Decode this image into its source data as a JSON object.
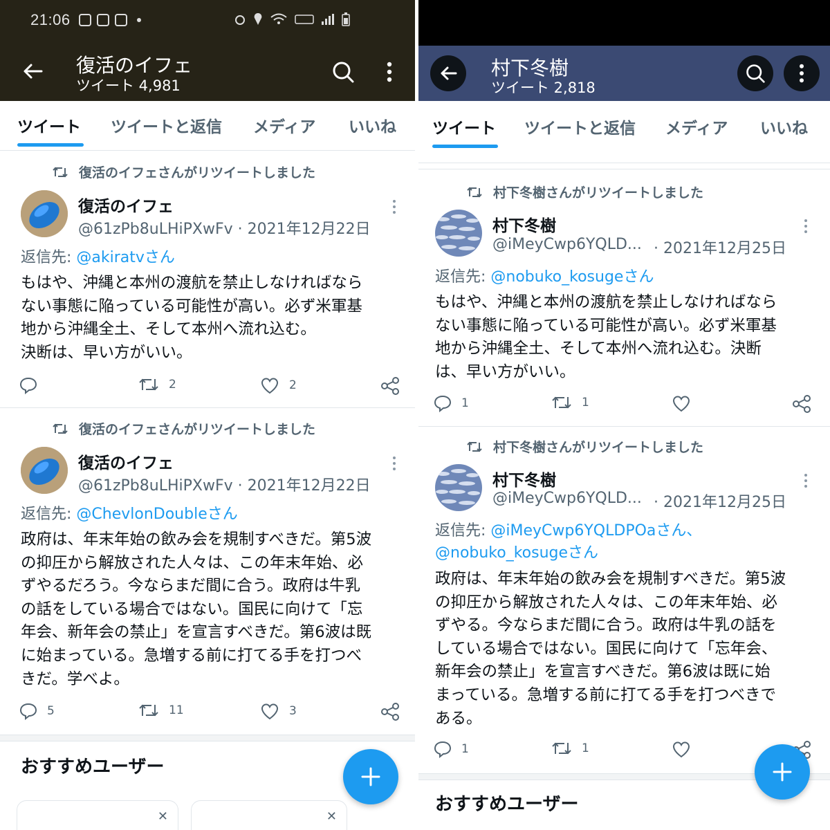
{
  "left": {
    "status_bar": {
      "time": "21:06"
    },
    "header": {
      "title": "復活のイフェ",
      "subtitle": "ツイート 4,981",
      "bg_color": "#262317"
    },
    "tabs": [
      {
        "label": "ツイート"
      },
      {
        "label": "ツイートと返信"
      },
      {
        "label": "メディア"
      },
      {
        "label": "いいね"
      }
    ],
    "tweets": [
      {
        "retweet_label": "復活のイフェさんがリツイートしました",
        "name": "復活のイフェ",
        "handle": "@61zPb8uLHiPXwFv · 2021年12月22日",
        "reply_prefix": "返信先: ",
        "reply_to": "@akiratvさん",
        "body": [
          "もはや、沖縄と本州の渡航を禁止しなければなら",
          "ない事態に陥っている可能性が高い。必ず米軍基",
          "地から沖縄全土、そして本州へ流れ込む。",
          "決断は、早い方がいい。"
        ],
        "replies": "",
        "retweets": "2",
        "likes": "2"
      },
      {
        "retweet_label": "復活のイフェさんがリツイートしました",
        "name": "復活のイフェ",
        "handle": "@61zPb8uLHiPXwFv · 2021年12月22日",
        "reply_prefix": "返信先: ",
        "reply_to": "@ChevlonDoubleさん",
        "body": [
          "政府は、年末年始の飲み会を規制すべきだ。第5波",
          "の抑圧から解放された人々は、この年末年始、必",
          "ずやるだろう。今ならまだ間に合う。政府は牛乳",
          "の話をしている場合ではない。国民に向けて「忘",
          "年会、新年会の禁止」を宣言すべきだ。第6波は既",
          "に始まっている。急増する前に打てる手を打つべ",
          "きだ。学べよ。"
        ],
        "replies": "5",
        "retweets": "11",
        "likes": "3"
      }
    ],
    "recommend_title": "おすすめユーザー"
  },
  "right": {
    "header": {
      "title": "村下冬樹",
      "subtitle": "ツイート 2,818",
      "bg_color": "#3b4a73"
    },
    "tabs": [
      {
        "label": "ツイート"
      },
      {
        "label": "ツイートと返信"
      },
      {
        "label": "メディア"
      },
      {
        "label": "いいね"
      }
    ],
    "tweets": [
      {
        "retweet_label": "村下冬樹さんがリツイートしました",
        "name": "村下冬樹",
        "handle": "@iMeyCwp6YQLD...",
        "date": "· 2021年12月25日",
        "reply_prefix": "返信先: ",
        "reply_to": "@nobuko_kosugeさん",
        "body": [
          "もはや、沖縄と本州の渡航を禁止しなければなら",
          "ない事態に陥っている可能性が高い。必ず米軍基",
          "地から沖縄全土、そして本州へ流れ込む。決断",
          "は、早い方がいい。"
        ],
        "replies": "1",
        "retweets": "1",
        "likes": ""
      },
      {
        "retweet_label": "村下冬樹さんがリツイートしました",
        "name": "村下冬樹",
        "handle": "@iMeyCwp6YQLD...",
        "date": "· 2021年12月25日",
        "reply_prefix": "返信先: ",
        "reply_to": "@iMeyCwp6YQLDPOaさん、",
        "reply_to_2": "@nobuko_kosugeさん",
        "body": [
          "政府は、年末年始の飲み会を規制すべきだ。第5波",
          "の抑圧から解放された人々は、この年末年始、必",
          "ずやる。今ならまだ間に合う。政府は牛乳の話を",
          "している場合ではない。国民に向けて「忘年会、",
          "新年会の禁止」を宣言すべきだ。第6波は既に始",
          "まっている。急増する前に打てる手を打つべきで",
          "ある。"
        ],
        "replies": "1",
        "retweets": "1",
        "likes": ""
      }
    ],
    "recommend_title": "おすすめユーザー"
  },
  "colors": {
    "accent": "#1d9bf0",
    "muted": "#536471",
    "text": "#0f1419"
  }
}
